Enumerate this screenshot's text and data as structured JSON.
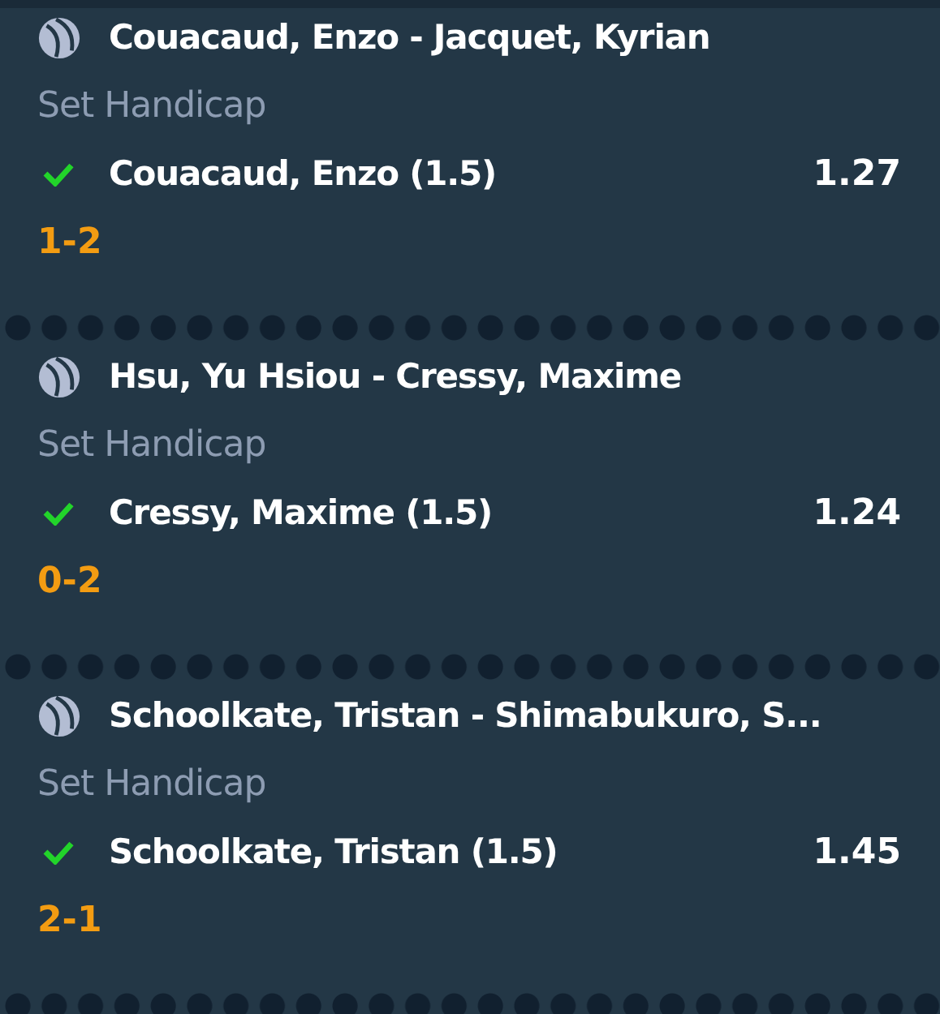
{
  "bets": [
    {
      "event": "Couacaud, Enzo - Jacquet, Kyrian",
      "market": "Set Handicap",
      "selection": "Couacaud, Enzo (1.5)",
      "won": true,
      "odds": "1.27",
      "score": "1-2"
    },
    {
      "event": "Hsu, Yu Hsiou - Cressy, Maxime",
      "market": "Set Handicap",
      "selection": "Cressy, Maxime (1.5)",
      "won": true,
      "odds": "1.24",
      "score": "0-2"
    },
    {
      "event": "Schoolkate, Tristan - Shimabukuro, S...",
      "market": "Set Handicap",
      "selection": "Schoolkate, Tristan (1.5)",
      "won": true,
      "odds": "1.45",
      "score": "2-1"
    }
  ]
}
